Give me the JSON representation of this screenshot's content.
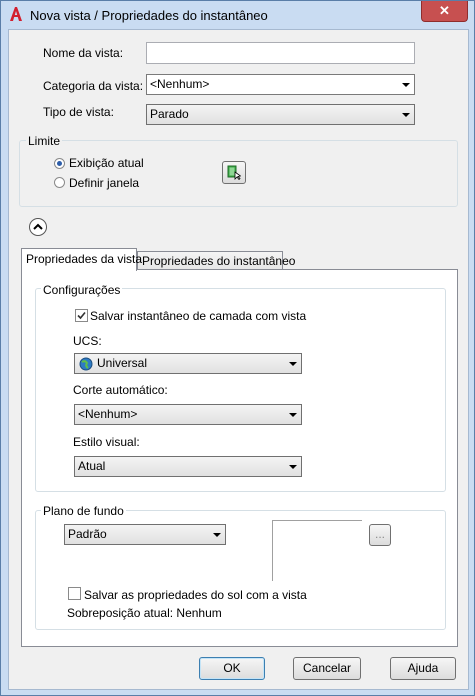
{
  "window": {
    "title": "Nova vista / Propriedades do instantâneo",
    "close_symbol": "✕"
  },
  "form": {
    "view_name_label": "Nome da vista:",
    "view_name_value": "",
    "view_category_label": "Categoria da vista:",
    "view_category_value": "<Nenhum>",
    "view_type_label": "Tipo de vista:",
    "view_type_value": "Parado"
  },
  "boundary": {
    "title": "Limite",
    "current_display_label": "Exibição atual",
    "define_window_label": "Definir janela",
    "selected": "current_display"
  },
  "tabs": [
    {
      "label": "Propriedades da vista",
      "active": true
    },
    {
      "label": "Propriedades do instantâneo",
      "active": false
    }
  ],
  "settings": {
    "title": "Configurações",
    "save_layer_snapshot_label": "Salvar instantâneo de camada com vista",
    "save_layer_snapshot_checked": true,
    "ucs_label": "UCS:",
    "ucs_value": "Universal",
    "live_section_label": "Corte automático:",
    "live_section_value": "<Nenhum>",
    "visual_style_label": "Estilo visual:",
    "visual_style_value": "Atual"
  },
  "background": {
    "title": "Plano de fundo",
    "value": "Padrão",
    "browse_label": "...",
    "save_sun_label": "Salvar as propriedades do sol com a vista",
    "save_sun_checked": false,
    "current_override_label": "Sobreposição atual: Nenhum"
  },
  "buttons": {
    "ok": "OK",
    "cancel": "Cancelar",
    "help": "Ajuda"
  }
}
